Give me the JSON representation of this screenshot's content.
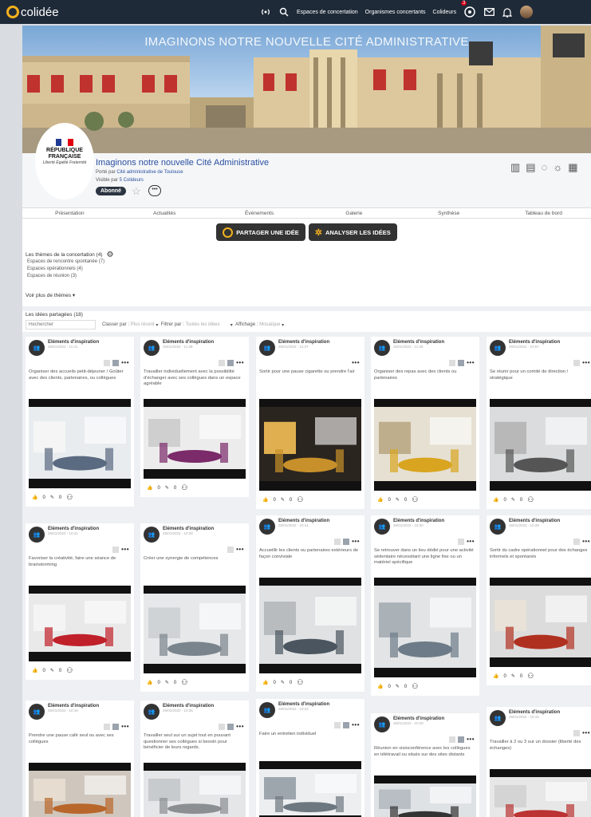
{
  "app": {
    "logo_text": "colidée"
  },
  "topnav": {
    "links": [
      "Espaces de concertation",
      "Organismes concertants",
      "Colideurs"
    ],
    "notif_count": "3"
  },
  "banner": {
    "title": "IMAGINONS NOTRE NOUVELLE CITÉ ADMINISTRATIVE"
  },
  "org": {
    "logo_lines": [
      "RÉPUBLIQUE",
      "FRANÇAISE"
    ],
    "motto": "Liberté Égalité Fraternité",
    "title": "Imaginons notre nouvelle Cité Administrative",
    "carried_by_prefix": "Porté par",
    "carried_by": "Cité administrative de Toulouse",
    "visible_by_prefix": "Visible par",
    "visible_by": "5 Colideurs",
    "subscribed": "Abonné"
  },
  "tabs": [
    "Présentation",
    "Actualités",
    "Événements",
    "Galerie",
    "Synthèse",
    "Tableau de bord"
  ],
  "actions": {
    "share": "PARTAGER UNE IDÉE",
    "analyse": "ANALYSER LES IDÉES"
  },
  "themes": {
    "title": "Les thèmes de la concertation (4)",
    "items": [
      "Espaces de rencontre spontanée (7)",
      "Espaces opérationnels (4)",
      "Espaces de réunion (3)"
    ],
    "more": "Voir plus de thèmes"
  },
  "ideas": {
    "title": "Les idées partagées (18)",
    "search_placeholder": "Rechercher",
    "sort_label": "Classer par :",
    "sort_value": "Plus récent",
    "filter_label": "Filtrer par :",
    "filter_value": "Toutes les idées",
    "display_label": "Affichage :",
    "display_value": "Mosaïque"
  },
  "cards": [
    {
      "author": "Eléments d'inspiration",
      "date": "26/01/2022 - 11:41",
      "text": "Organiser des accueils petit-déjeuner / Goûter avec des clients, partenaires, ou collègues",
      "likes": "0",
      "comments": "0"
    },
    {
      "author": "Eléments d'inspiration",
      "date": "26/01/2022 - 11:38",
      "text": "Travailler individuellement avec la possibilité d'échanger avec ses collègues dans un espace agréable",
      "likes": "0",
      "comments": "0"
    },
    {
      "author": "Eléments d'inspiration",
      "date": "26/01/2022 - 11:37",
      "text": "Sortir pour une pause cigarette ou prendre l'air",
      "likes": "0",
      "comments": "0"
    },
    {
      "author": "Eléments d'inspiration",
      "date": "26/01/2022 - 11:35",
      "text": "Organiser des repas avec des clients ou partenaires",
      "likes": "0",
      "comments": "0"
    },
    {
      "author": "Eléments d'inspiration",
      "date": "26/01/2022 - 10:57",
      "text": "Se réunir pour un comité de direction / stratégique",
      "likes": "0",
      "comments": "0"
    },
    {
      "author": "Eléments d'inspiration",
      "date": "26/01/2022 - 10:41",
      "text": "Favoriser la créativité, faire une séance de brainstorming",
      "likes": "0",
      "comments": "0"
    },
    {
      "author": "Eléments d'inspiration",
      "date": "26/01/2022 - 10:28",
      "text": "Créer une synergie de compétences",
      "likes": "0",
      "comments": "0"
    },
    {
      "author": "Eléments d'inspiration",
      "date": "26/01/2022 - 10:41",
      "text": "Accueillir les clients ou partenaires extérieurs de façon conviviale",
      "likes": "0",
      "comments": "0"
    },
    {
      "author": "Eléments d'inspiration",
      "date": "26/01/2022 - 10:30",
      "text": "Se retrouver dans un lieu dédié pour une activité sédentaire nécessitant une ligne fixe ou un matériel spécifique",
      "likes": "0",
      "comments": "0"
    },
    {
      "author": "Eléments d'inspiration",
      "date": "26/01/2022 - 10:28",
      "text": "Sortir du cadre opérationnel pour des échanges informels et spontanés",
      "likes": "0",
      "comments": "0"
    },
    {
      "author": "Eléments d'inspiration",
      "date": "26/01/2022 - 10:16",
      "text": "Prendre une pause café seul ou avec ses collègues",
      "likes": "0",
      "comments": "0"
    },
    {
      "author": "Eléments d'inspiration",
      "date": "26/01/2022 - 10:26",
      "text": "Travailler seul sur un sujet tout en pouvant questionner ses collègues si besoin pour bénéficier de leurs regards.",
      "likes": "0",
      "comments": "0"
    },
    {
      "author": "Eléments d'inspiration",
      "date": "26/01/2022 - 10:22",
      "text": "Faire un entretien individuel",
      "likes": "0",
      "comments": "0"
    },
    {
      "author": "Eléments d'inspiration",
      "date": "26/01/2022 - 10:20",
      "text": "Réunion en visioconférence avec les collègues en télétravail ou situés sur des sites distants",
      "likes": "0",
      "comments": "0"
    },
    {
      "author": "Eléments d'inspiration",
      "date": "26/01/2022 - 10:15",
      "text": "Travailler à 2 ou 3 sur un dossier (liberté des échanges)",
      "likes": "0",
      "comments": "0"
    }
  ]
}
